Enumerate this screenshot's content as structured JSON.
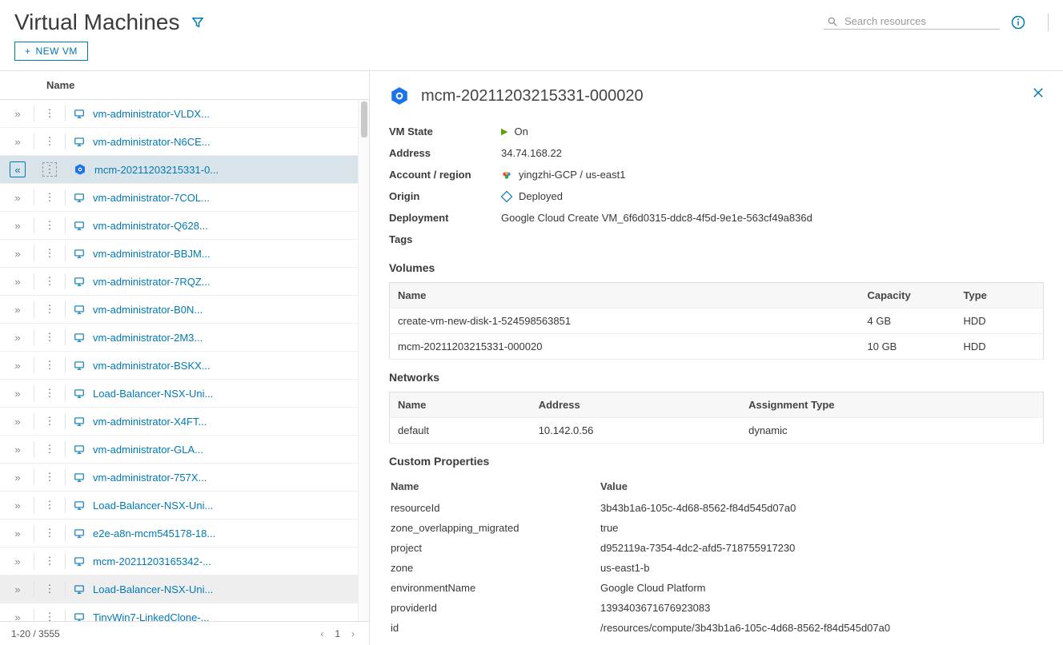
{
  "header": {
    "title": "Virtual Machines",
    "search_placeholder": "Search resources",
    "new_vm_label": "NEW VM"
  },
  "list": {
    "column_name": "Name",
    "page_info": "1-20 / 3555",
    "page_number": "1",
    "items": [
      {
        "name": "vm-administrator-VLDX...",
        "type": "vm"
      },
      {
        "name": "vm-administrator-N6CE...",
        "type": "vm"
      },
      {
        "name": "mcm-20211203215331-0...",
        "type": "gcp",
        "selected": true
      },
      {
        "name": "vm-administrator-7COL...",
        "type": "vm"
      },
      {
        "name": "vm-administrator-Q628...",
        "type": "vm"
      },
      {
        "name": "vm-administrator-BBJM...",
        "type": "vm"
      },
      {
        "name": "vm-administrator-7RQZ...",
        "type": "vm"
      },
      {
        "name": "vm-administrator-B0N...",
        "type": "vm"
      },
      {
        "name": "vm-administrator-2M3...",
        "type": "vm"
      },
      {
        "name": "vm-administrator-BSKX...",
        "type": "vm"
      },
      {
        "name": "Load-Balancer-NSX-Uni...",
        "type": "vm"
      },
      {
        "name": "vm-administrator-X4FT...",
        "type": "vm"
      },
      {
        "name": "vm-administrator-GLA...",
        "type": "vm"
      },
      {
        "name": "vm-administrator-757X...",
        "type": "vm"
      },
      {
        "name": "Load-Balancer-NSX-Uni...",
        "type": "vm"
      },
      {
        "name": "e2e-a8n-mcm545178-18...",
        "type": "vm"
      },
      {
        "name": "mcm-20211203165342-...",
        "type": "vm"
      },
      {
        "name": "Load-Balancer-NSX-Uni...",
        "type": "vm",
        "hovered": true
      },
      {
        "name": "TinyWin7-LinkedClone-...",
        "type": "vm"
      }
    ]
  },
  "detail": {
    "title": "mcm-20211203215331-000020",
    "kv": {
      "state_label": "VM State",
      "state_value": "On",
      "address_label": "Address",
      "address_value": "34.74.168.22",
      "account_label": "Account / region",
      "account_value": "yingzhi-GCP / us-east1",
      "origin_label": "Origin",
      "origin_value": "Deployed",
      "deployment_label": "Deployment",
      "deployment_value": "Google Cloud Create VM_6f6d0315-ddc8-4f5d-9e1e-563cf49a836d",
      "tags_label": "Tags"
    },
    "volumes": {
      "title": "Volumes",
      "headers": {
        "name": "Name",
        "capacity": "Capacity",
        "type": "Type"
      },
      "rows": [
        {
          "name": "create-vm-new-disk-1-524598563851",
          "capacity": "4 GB",
          "type": "HDD"
        },
        {
          "name": "mcm-20211203215331-000020",
          "capacity": "10 GB",
          "type": "HDD"
        }
      ]
    },
    "networks": {
      "title": "Networks",
      "headers": {
        "name": "Name",
        "address": "Address",
        "assign": "Assignment Type"
      },
      "rows": [
        {
          "name": "default",
          "address": "10.142.0.56",
          "assign": "dynamic"
        }
      ]
    },
    "custom": {
      "title": "Custom Properties",
      "headers": {
        "name": "Name",
        "value": "Value"
      },
      "rows": [
        {
          "name": "resourceId",
          "value": "3b43b1a6-105c-4d68-8562-f84d545d07a0"
        },
        {
          "name": "zone_overlapping_migrated",
          "value": "true"
        },
        {
          "name": "project",
          "value": "d952119a-7354-4dc2-afd5-718755917230"
        },
        {
          "name": "zone",
          "value": "us-east1-b"
        },
        {
          "name": "environmentName",
          "value": "Google Cloud Platform"
        },
        {
          "name": "providerId",
          "value": "1393403671676923083"
        },
        {
          "name": "id",
          "value": "/resources/compute/3b43b1a6-105c-4d68-8562-f84d545d07a0"
        }
      ]
    }
  }
}
